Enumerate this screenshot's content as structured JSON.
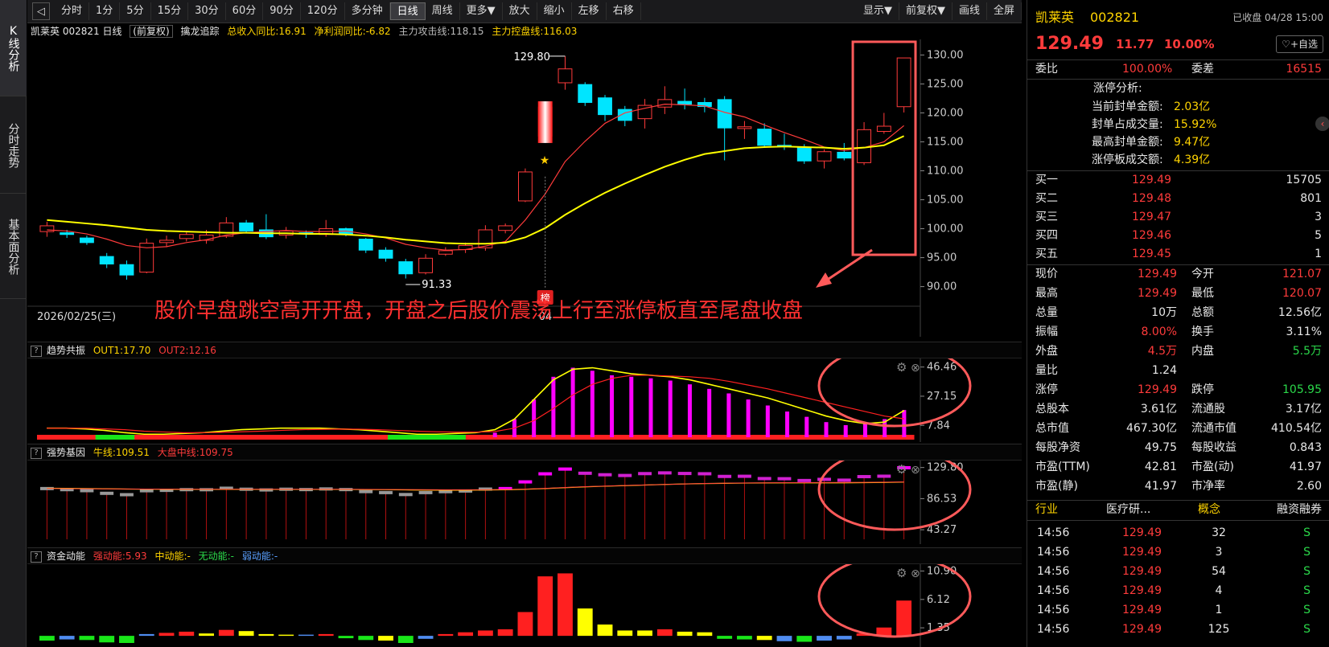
{
  "side_tabs": [
    "K线分析",
    "分时走势",
    "基本面分析"
  ],
  "toolbar": {
    "back_label": "◁",
    "items": [
      "分时",
      "1分",
      "5分",
      "15分",
      "30分",
      "60分",
      "90分",
      "120分",
      "多分钟",
      "日线",
      "周线",
      "更多▼",
      "放大",
      "缩小",
      "左移",
      "右移"
    ],
    "active": "日线",
    "right_items": [
      "显示▼",
      "前复权▼",
      "画线",
      "全屏"
    ]
  },
  "main_info": {
    "stock": "凯莱英 002821 日线",
    "fq": "(前复权)",
    "indicator": "擒龙追踪",
    "revenue": "总收入同比:16.91",
    "profit": "净利润同比:-6.82",
    "attack": "主力攻击线:118.15",
    "control": "主力控盘线:116.03"
  },
  "annotation": {
    "text": "股价早盘跳空高开开盘，开盘之后股价震荡上行至涨停板直至尾盘收盘",
    "high_label": "129.80",
    "low_label": "91.33",
    "date_label": "2026/02/25(三)",
    "date_tick": "04",
    "bang": "榜"
  },
  "colors": {
    "up": "#ff3b3b",
    "down": "#00e5ff",
    "ma_fast": "#ff3b3b",
    "ma_slow": "#ffff00",
    "accent": "#ff6060"
  },
  "chart_data": [
    {
      "type": "candlestick",
      "name": "main",
      "ylim": [
        88,
        132
      ],
      "yticks": [
        "130.00",
        "125.00",
        "120.00",
        "115.00",
        "110.00",
        "105.00",
        "100.00",
        "95.00",
        "90.00"
      ],
      "candles": [
        [
          99.5,
          100.5,
          98.6,
          101.2
        ],
        [
          99.3,
          99.0,
          98.4,
          99.8
        ],
        [
          98.4,
          97.6,
          97.2,
          98.8
        ],
        [
          95.2,
          93.9,
          93.2,
          95.8
        ],
        [
          93.8,
          92.0,
          91.2,
          94.5
        ],
        [
          92.5,
          97.5,
          92.3,
          98.3
        ],
        [
          97.6,
          98.0,
          96.8,
          98.8
        ],
        [
          98.3,
          99.0,
          97.8,
          99.5
        ],
        [
          98.0,
          98.9,
          97.4,
          99.8
        ],
        [
          98.7,
          101.0,
          98.4,
          102.0
        ],
        [
          101.0,
          99.6,
          99.3,
          101.5
        ],
        [
          99.8,
          98.6,
          98.2,
          102.5
        ],
        [
          98.9,
          99.6,
          98.3,
          100.3
        ],
        [
          99.3,
          99.1,
          98.4,
          99.7
        ],
        [
          99.0,
          100.0,
          98.6,
          101.5
        ],
        [
          100.0,
          99.1,
          98.7,
          100.2
        ],
        [
          98.2,
          96.3,
          95.8,
          98.4
        ],
        [
          96.3,
          94.9,
          94.3,
          96.8
        ],
        [
          94.3,
          92.2,
          91.4,
          94.8
        ],
        [
          92.4,
          94.9,
          92.1,
          95.6
        ],
        [
          95.6,
          96.2,
          95.3,
          96.8
        ],
        [
          96.4,
          97.1,
          95.8,
          97.6
        ],
        [
          96.7,
          99.8,
          96.2,
          100.6
        ],
        [
          99.7,
          100.5,
          99.2,
          100.9
        ],
        [
          104.8,
          109.8,
          104.6,
          110.4
        ],
        [
          116.0,
          121.0,
          115.2,
          121.5
        ],
        [
          125.2,
          127.6,
          124.0,
          129.8
        ],
        [
          124.9,
          121.8,
          121.2,
          125.3
        ],
        [
          122.6,
          119.7,
          118.6,
          123.1
        ],
        [
          120.6,
          118.7,
          117.7,
          121.2
        ],
        [
          119.0,
          121.3,
          117.3,
          122.4
        ],
        [
          121.0,
          122.3,
          119.8,
          124.6
        ],
        [
          122.0,
          121.5,
          120.6,
          124.2
        ],
        [
          121.8,
          121.1,
          120.1,
          122.6
        ],
        [
          122.3,
          117.4,
          111.8,
          122.9
        ],
        [
          117.3,
          117.6,
          115.5,
          118.6
        ],
        [
          117.2,
          114.4,
          114.0,
          118.2
        ],
        [
          114.4,
          114.2,
          113.6,
          116.4
        ],
        [
          114.0,
          111.7,
          111.2,
          114.6
        ],
        [
          111.7,
          113.3,
          110.4,
          113.7
        ],
        [
          113.2,
          112.2,
          111.8,
          114.8
        ],
        [
          111.4,
          117.1,
          111.0,
          118.4
        ],
        [
          116.8,
          117.7,
          116.4,
          120.0
        ],
        [
          121.07,
          129.49,
          120.07,
          129.49
        ]
      ],
      "ma_fast": [
        99.8,
        99.6,
        99.1,
        98.2,
        97.1,
        96.7,
        96.9,
        97.6,
        98.1,
        98.9,
        99.3,
        99.5,
        99.7,
        99.5,
        99.5,
        99.6,
        99.1,
        98.4,
        97.3,
        96.7,
        96.3,
        96.4,
        97.0,
        97.8,
        101.5,
        106.0,
        111.6,
        115.1,
        118.2,
        120.0,
        120.8,
        121.5,
        121.4,
        121.2,
        120.1,
        119.3,
        117.9,
        116.6,
        115.4,
        114.1,
        113.5,
        114.0,
        115.0,
        117.8
      ],
      "ma_slow": [
        101.5,
        101.2,
        100.9,
        100.6,
        100.2,
        99.8,
        99.6,
        99.5,
        99.4,
        99.3,
        99.3,
        99.2,
        99.2,
        99.1,
        99.1,
        99.0,
        98.8,
        98.5,
        98.1,
        97.8,
        97.5,
        97.4,
        97.4,
        97.6,
        98.5,
        100.1,
        102.4,
        104.4,
        106.2,
        107.8,
        109.3,
        110.7,
        111.9,
        112.9,
        113.4,
        113.9,
        114.1,
        114.2,
        114.1,
        114.0,
        113.8,
        114.0,
        114.4,
        116.0
      ]
    },
    {
      "type": "bar+line",
      "name": "趋势共振",
      "legend": [
        "OUT1:17.70",
        "OUT2:12.16"
      ],
      "yticks": [
        "46.46",
        "27.15",
        "7.84"
      ],
      "ylim": [
        0,
        50
      ],
      "values": [
        0,
        0,
        0,
        0,
        0,
        0,
        0,
        0,
        0,
        0,
        0,
        0,
        0,
        0,
        0,
        0,
        0,
        0,
        0,
        0,
        0,
        0,
        0,
        3.0,
        12.0,
        25.0,
        40.0,
        46.0,
        44.0,
        41.0,
        40.0,
        39.0,
        37.5,
        35.0,
        32.0,
        29.0,
        25.0,
        21.0,
        17.0,
        13.5,
        10.0,
        8.0,
        9.0,
        12.0,
        18.0
      ],
      "out1": [
        6,
        6,
        5.5,
        4.5,
        3,
        2,
        2,
        2.5,
        3,
        4,
        5,
        5.5,
        6,
        6,
        6,
        5.5,
        5,
        4,
        3,
        2,
        2,
        2.5,
        3,
        5,
        12,
        25,
        38,
        45,
        46,
        44,
        42,
        41,
        40,
        38,
        35,
        32,
        29,
        26,
        22,
        18,
        14,
        11,
        9,
        10,
        17.7
      ],
      "out2": [
        6,
        6,
        6,
        5.5,
        5,
        4,
        3.5,
        3,
        3,
        3.2,
        3.6,
        4,
        4.5,
        5,
        5.2,
        5.4,
        5.3,
        5,
        4.5,
        4,
        3.6,
        3.4,
        3.4,
        3.8,
        6,
        11,
        19,
        28,
        35,
        39,
        41,
        41,
        40.5,
        40,
        39,
        37,
        34.5,
        32,
        29,
        26,
        23,
        20,
        17,
        14,
        12.16
      ],
      "bar_colors": [
        "red",
        "red",
        "red",
        "green",
        "green",
        "red",
        "red",
        "red",
        "red",
        "red",
        "red",
        "red",
        "red",
        "red",
        "red",
        "red",
        "red",
        "red",
        "green",
        "green",
        "green",
        "green",
        "red",
        "red",
        "red",
        "red",
        "red",
        "red",
        "red",
        "red",
        "red",
        "red",
        "red",
        "red",
        "red",
        "red",
        "red",
        "red",
        "red",
        "red",
        "red",
        "red",
        "red",
        "red",
        "red"
      ]
    },
    {
      "type": "bar+line",
      "name": "强势基因",
      "legend": [
        "牛线:109.51",
        "大盘中线:109.75"
      ],
      "yticks": [
        "129.80",
        "86.53",
        "43.27"
      ],
      "ylim": [
        30,
        135
      ],
      "values": [
        100.5,
        99.0,
        97.6,
        93.9,
        92.0,
        97.5,
        98.0,
        99.0,
        98.9,
        101.0,
        99.6,
        98.6,
        99.6,
        99.1,
        100.0,
        99.1,
        96.3,
        94.9,
        92.2,
        94.9,
        96.2,
        97.1,
        99.8,
        100.5,
        109.8,
        121.0,
        127.6,
        121.8,
        119.7,
        118.7,
        121.3,
        122.3,
        121.5,
        121.1,
        117.4,
        117.6,
        114.4,
        114.2,
        111.7,
        113.3,
        112.2,
        117.1,
        117.7,
        129.49
      ],
      "line1": [
        101,
        100.8,
        100.5,
        100.2,
        99.8,
        99.6,
        99.5,
        99.4,
        99.3,
        99.4,
        99.4,
        99.3,
        99.3,
        99.3,
        99.3,
        99.3,
        99.1,
        98.9,
        98.6,
        98.4,
        98.3,
        98.3,
        98.5,
        98.8,
        99.5,
        100.5,
        101.8,
        102.9,
        103.8,
        104.6,
        105.4,
        106.2,
        106.9,
        107.5,
        107.8,
        108.1,
        108.3,
        108.4,
        108.4,
        108.5,
        108.5,
        108.7,
        109.0,
        109.51
      ],
      "line2": [
        100.6,
        100.4,
        100.3,
        100.1,
        99.9,
        99.8,
        99.7,
        99.6,
        99.6,
        99.6,
        99.6,
        99.6,
        99.6,
        99.5,
        99.5,
        99.5,
        99.4,
        99.3,
        99.1,
        99.0,
        98.9,
        98.9,
        99.0,
        99.2,
        99.8,
        100.8,
        102.0,
        103.1,
        104.0,
        104.8,
        105.6,
        106.3,
        107.0,
        107.6,
        108.0,
        108.3,
        108.5,
        108.7,
        108.8,
        108.9,
        109.0,
        109.2,
        109.4,
        109.75
      ]
    },
    {
      "type": "bar",
      "name": "资金动能",
      "legend": [
        "强动能:5.93",
        "中动能:-",
        "无动能:-",
        "弱动能:-"
      ],
      "yticks": [
        "10.90",
        "6.12",
        "1.35"
      ],
      "ylim": [
        -1.2,
        11.5
      ],
      "values": [
        -0.8,
        -0.6,
        -0.7,
        -1.1,
        -1.2,
        0.3,
        0.5,
        0.7,
        0.4,
        1.0,
        0.8,
        0.3,
        0.2,
        0.2,
        0.3,
        -0.4,
        -0.7,
        -0.8,
        -1.2,
        -0.5,
        0.3,
        0.6,
        0.9,
        1.1,
        4.0,
        10.0,
        10.5,
        4.6,
        1.9,
        0.9,
        0.9,
        1.1,
        0.7,
        0.6,
        -0.5,
        -0.6,
        -0.7,
        -0.9,
        -1.0,
        -0.8,
        -0.6,
        0.4,
        1.4,
        5.93
      ],
      "colors": [
        "green",
        "blue",
        "green",
        "green",
        "green",
        "blue",
        "red",
        "red",
        "yellow",
        "red",
        "yellow",
        "yellow",
        "yellow",
        "blue",
        "red",
        "green",
        "green",
        "yellow",
        "green",
        "blue",
        "red",
        "red",
        "red",
        "red",
        "red",
        "red",
        "red",
        "yellow",
        "yellow",
        "yellow",
        "yellow",
        "red",
        "yellow",
        "yellow",
        "green",
        "green",
        "yellow",
        "blue",
        "green",
        "blue",
        "blue",
        "red",
        "red",
        "red"
      ]
    }
  ],
  "quote": {
    "name": "凯莱英",
    "code": "002821",
    "status": "已收盘 04/28 15:00",
    "price": "129.49",
    "change": "11.77",
    "pct": "10.00%",
    "watch": "+自选",
    "wb_label": "委比",
    "wb_value": "100.00%",
    "wc_label": "委差",
    "wc_value": "16515",
    "limit_title": "涨停分析:",
    "limit_rows": [
      {
        "label": "当前封单金额:",
        "value": "2.03亿"
      },
      {
        "label": "封单占成交量:",
        "value": "15.92%"
      },
      {
        "label": "最高封单金额:",
        "value": "9.47亿"
      },
      {
        "label": "涨停板成交额:",
        "value": "4.39亿"
      }
    ],
    "bids": [
      {
        "label": "买一",
        "price": "129.49",
        "vol": "15705"
      },
      {
        "label": "买二",
        "price": "129.48",
        "vol": "801"
      },
      {
        "label": "买三",
        "price": "129.47",
        "vol": "3"
      },
      {
        "label": "买四",
        "price": "129.46",
        "vol": "5"
      },
      {
        "label": "买五",
        "price": "129.45",
        "vol": "1"
      }
    ],
    "stats": [
      {
        "l1": "现价",
        "v1": "129.49",
        "c1": "red",
        "l2": "今开",
        "v2": "121.07",
        "c2": "red"
      },
      {
        "l1": "最高",
        "v1": "129.49",
        "c1": "red",
        "l2": "最低",
        "v2": "120.07",
        "c2": "red"
      },
      {
        "l1": "总量",
        "v1": "10万",
        "c1": "white",
        "l2": "总额",
        "v2": "12.56亿",
        "c2": "white"
      },
      {
        "l1": "振幅",
        "v1": "8.00%",
        "c1": "red",
        "l2": "换手",
        "v2": "3.11%",
        "c2": "white"
      },
      {
        "l1": "外盘",
        "v1": "4.5万",
        "c1": "red",
        "l2": "内盘",
        "v2": "5.5万",
        "c2": "green"
      },
      {
        "l1": "量比",
        "v1": "1.24",
        "c1": "white",
        "l2": "",
        "v2": "",
        "c2": "white"
      },
      {
        "l1": "涨停",
        "v1": "129.49",
        "c1": "red",
        "l2": "跌停",
        "v2": "105.95",
        "c2": "green"
      },
      {
        "l1": "总股本",
        "v1": "3.61亿",
        "c1": "white",
        "l2": "流通股",
        "v2": "3.17亿",
        "c2": "white"
      },
      {
        "l1": "总市值",
        "v1": "467.30亿",
        "c1": "white",
        "l2": "流通市值",
        "v2": "410.54亿",
        "c2": "white"
      },
      {
        "l1": "每股净资",
        "v1": "49.75",
        "c1": "white",
        "l2": "每股收益",
        "v2": "0.843",
        "c2": "white"
      },
      {
        "l1": "市盈(TTM)",
        "v1": "42.81",
        "c1": "white",
        "l2": "市盈(动)",
        "v2": "41.97",
        "c2": "white"
      },
      {
        "l1": "市盈(静)",
        "v1": "41.97",
        "c1": "white",
        "l2": "市净率",
        "v2": "2.60",
        "c2": "white"
      }
    ],
    "industry_row": {
      "a": "行业",
      "b": "医疗研...",
      "c": "概念",
      "d": "融资融券"
    },
    "ticks": [
      {
        "time": "14:56",
        "price": "129.49",
        "vol": "32",
        "bs": "S"
      },
      {
        "time": "14:56",
        "price": "129.49",
        "vol": "3",
        "bs": "S"
      },
      {
        "time": "14:56",
        "price": "129.49",
        "vol": "54",
        "bs": "S"
      },
      {
        "time": "14:56",
        "price": "129.49",
        "vol": "4",
        "bs": "S"
      },
      {
        "time": "14:56",
        "price": "129.49",
        "vol": "1",
        "bs": "S"
      },
      {
        "time": "14:56",
        "price": "129.49",
        "vol": "125",
        "bs": "S"
      }
    ]
  }
}
